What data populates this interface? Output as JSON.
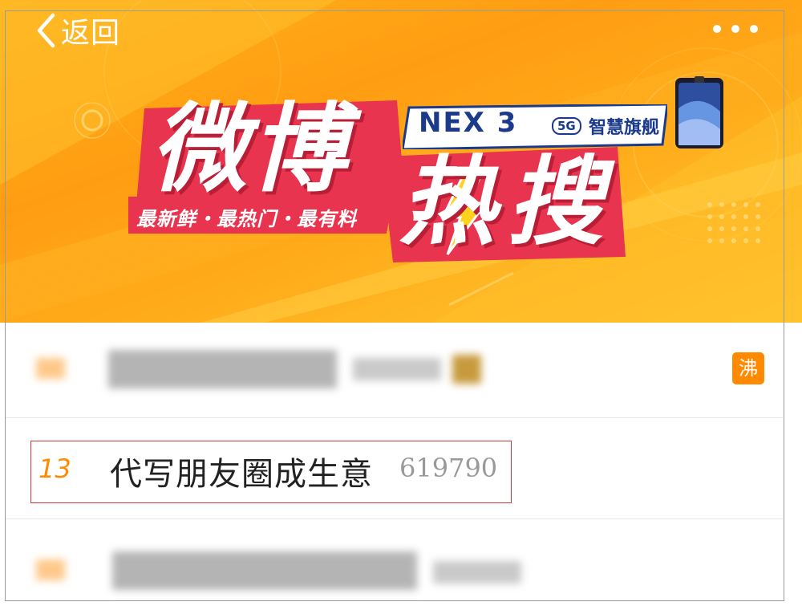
{
  "nav": {
    "back_label": "返回",
    "back_icon": "chevron-left-icon",
    "more_icon": "more-dots-icon"
  },
  "banner": {
    "logo_line1": "微博",
    "logo_line2": "热搜",
    "slogan": "最新鲜・最热门・最有料",
    "ad_brand": "NEX 3",
    "ad_badge": "5G",
    "ad_tagline": "智慧旗舰",
    "colors": {
      "background": "#ffa614",
      "logo_red": "#e8344e",
      "ad_blue": "#1b3a8c"
    }
  },
  "hot_list": {
    "items": [
      {
        "blurred": true,
        "badge": "沸",
        "badge_color": "#ff8a00"
      },
      {
        "blurred": false,
        "rank": "13",
        "title": "代写朋友圈成生意",
        "count": "619790",
        "highlighted": true
      },
      {
        "blurred": true
      }
    ]
  },
  "colors": {
    "rank": "#ff8a00",
    "highlight_border": "#d23a3a",
    "count": "#999999"
  }
}
